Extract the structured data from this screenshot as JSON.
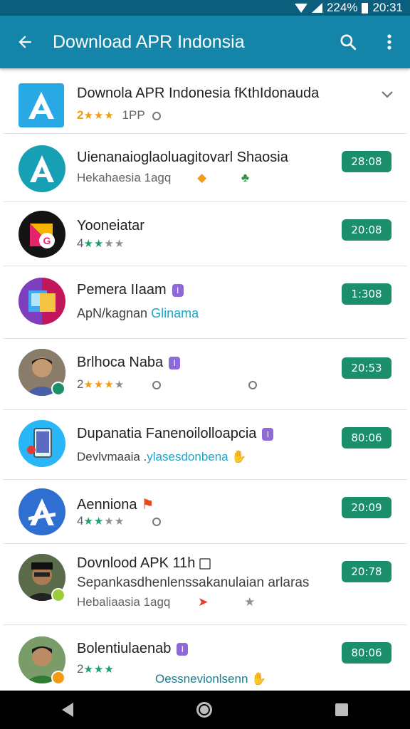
{
  "status_bar": {
    "battery_percent": "224%",
    "time": "20:31"
  },
  "app_bar": {
    "title": "Download APR Indonsia"
  },
  "header_item": {
    "name": "Downola APR Indonesia  fKthIdonauda",
    "rating_prefix": "2",
    "meta": "1PP"
  },
  "items": [
    {
      "name": "Uienanaioglaoluagitovarl Shaosia",
      "sub": "Hekahaesia   1agq",
      "button": "28:08"
    },
    {
      "name": "Yooneiatar",
      "sub": "4",
      "button": "20:08"
    },
    {
      "name": "Pemera IIaam",
      "chip": "I",
      "sub": "ApN/kagnan",
      "sub_link": "Glinama",
      "button": "1:308"
    },
    {
      "name": "Brlhoca Naba",
      "chip": "I",
      "sub": "2",
      "button": "20:53"
    },
    {
      "name": "Dupanatia Fanenoilolloapcia",
      "chip": "I",
      "sub": "Devlvmaaia .",
      "sub_link": "ylasesdonbena",
      "button": "80:06"
    },
    {
      "name": "Aenniona",
      "sub": "4",
      "button": "20:09"
    },
    {
      "name": "Dovnlood APK 11h",
      "line2": "Sepankasdhenlenssakanulaian arlaras",
      "sub": "Hebaliaasia   1agq",
      "button": "20:78"
    },
    {
      "name": "Bolentiulaenab",
      "chip": "I",
      "sub": "2",
      "sub_link": "Oessnevionlsenn",
      "button": "80:06"
    }
  ],
  "icons": {
    "back": "arrow-left-icon",
    "search": "search-icon",
    "menu": "more-vert-icon",
    "expand": "chevron-down-icon"
  },
  "colors": {
    "status_bar": "#0b5f7c",
    "app_bar": "#1484a8",
    "install_button": "#1b8f6c",
    "star_green": "#1e9e6b",
    "star_gold": "#f29c13"
  }
}
